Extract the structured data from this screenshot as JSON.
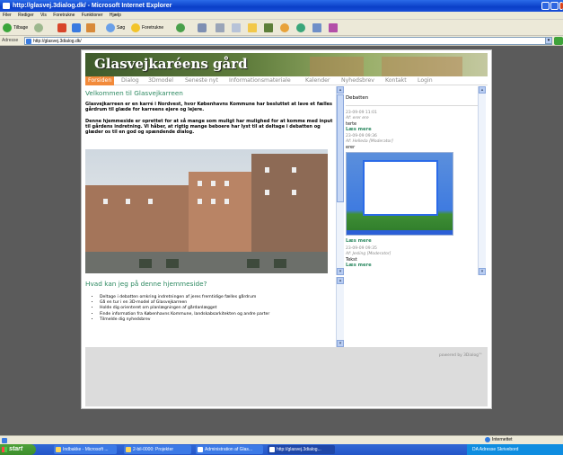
{
  "window": {
    "title": "http://glasvej.3dialog.dk/ - Microsoft Internet Explorer"
  },
  "menu": [
    "Filer",
    "Rediger",
    "Vis",
    "Foretrukne",
    "Funktioner",
    "Hjælp"
  ],
  "toolbar": {
    "back_label": "Tilbage",
    "search_label": "Søg",
    "favorites_label": "Foretrukne"
  },
  "address": {
    "label": "Adresse",
    "url": "http://glasvej.3dialog.dk/"
  },
  "site": {
    "title": "Glasvejkaréens gård",
    "nav": [
      "Forsiden",
      "Dialog",
      "3Dmodel",
      "Seneste nyt",
      "Informationsmateriale",
      "Kalender",
      "Nyhedsbrev",
      "Kontakt",
      "Login"
    ],
    "active_nav": "Forsiden"
  },
  "main": {
    "heading": "Velkommen til Glasvejkarreen",
    "intro_1": "Glasvejkarreen er en karré i Nordvest, hvor Københavns Kommune har besluttet at lave et fælles gårdrum til glæde for karreens ejere og lejere.",
    "intro_2": "Denne hjemmeside er oprettet for at så mange som muligt har mulighed for at komme med input til gårdens indretning. Vi håber, at rigtig mange beboere har lyst til at deltage i debatten og glæder os til en god og spændende dialog.",
    "section_heading": "Hvad kan jeg på denne hjemmeside?",
    "bullets": [
      "Deltage i debatten omkring indretningen af jeres fremtidige fælles gårdrum",
      "Gå en tur i en 3D-model af Glasvejkarreen",
      "Holde dig orienteret om planlægningen af gårdanlægget",
      "Finde information fra Københavns Kommune, landskabsarkitekten og andre parter",
      "Tilmelde dig nyhedsbrev"
    ]
  },
  "sidebar": {
    "title": "Debatten",
    "posts": [
      {
        "date": "23-09-09 11:01",
        "author": "Af: erer ere",
        "text": "terte",
        "link": "Læs mere"
      },
      {
        "date": "23-09-09 09:36",
        "author": "Af: Helleda [Moderator]",
        "text": "erer",
        "link": "Læs mere"
      },
      {
        "date": "23-09-09 09:35",
        "author": "Af: Jesling [Moderator]",
        "text": "Tekst",
        "link": "Læs mere"
      }
    ]
  },
  "footer": {
    "powered": "powered by 3Dialog™"
  },
  "status": {
    "zone": "Internettet"
  },
  "taskbar": {
    "start": "start",
    "tasks": [
      "Indbakke - Microsoft ...",
      "2-bil-0000: Projekter",
      "Administration af Glas...",
      "http://glasvej.3dialog..."
    ],
    "tray": "DA   Adresse   Skrivebord"
  }
}
